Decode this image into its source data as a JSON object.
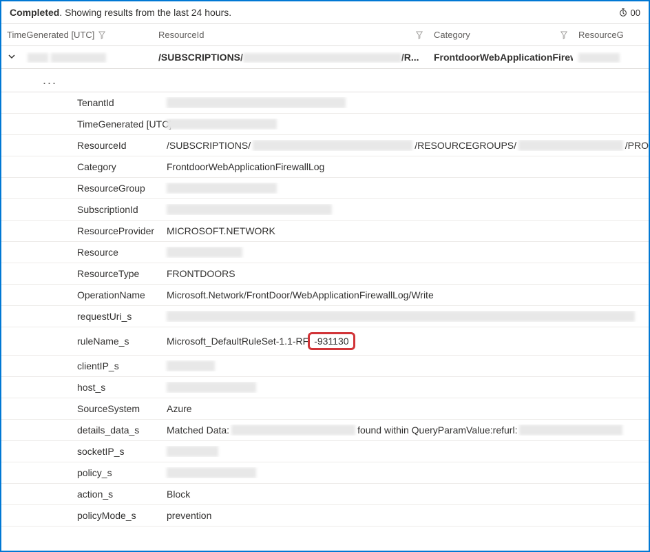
{
  "status": {
    "completed_label": "Completed",
    "subtext": ". Showing results from the last 24 hours.",
    "timer_text": "00"
  },
  "columns": {
    "time_generated": "TimeGenerated [UTC]",
    "resource_id": "ResourceId",
    "category": "Category",
    "resource_group": "ResourceG"
  },
  "result_row": {
    "resource_id_prefix": "/SUBSCRIPTIONS/",
    "resource_id_suffix": "/R...",
    "category": "FrontdoorWebApplicationFirewal..."
  },
  "ellipsis": "...",
  "details": {
    "TenantId": {
      "label": "TenantId",
      "value": ""
    },
    "TimeGenerated": {
      "label": "TimeGenerated [UTC]",
      "value": ""
    },
    "ResourceId": {
      "label": "ResourceId",
      "prefix": "/SUBSCRIPTIONS/",
      "mid": "/RESOURCEGROUPS/",
      "suffix": "/PRO"
    },
    "Category": {
      "label": "Category",
      "value": "FrontdoorWebApplicationFirewallLog"
    },
    "ResourceGroup": {
      "label": "ResourceGroup",
      "value": ""
    },
    "SubscriptionId": {
      "label": "SubscriptionId",
      "value": ""
    },
    "ResourceProvider": {
      "label": "ResourceProvider",
      "value": "MICROSOFT.NETWORK"
    },
    "Resource": {
      "label": "Resource",
      "value": ""
    },
    "ResourceType": {
      "label": "ResourceType",
      "value": "FRONTDOORS"
    },
    "OperationName": {
      "label": "OperationName",
      "value": "Microsoft.Network/FrontDoor/WebApplicationFirewallLog/Write"
    },
    "requestUri_s": {
      "label": "requestUri_s",
      "value": ""
    },
    "ruleName_s": {
      "label": "ruleName_s",
      "prefix": "Microsoft_DefaultRuleSet-1.1-RF",
      "highlighted": "-931130"
    },
    "clientIP_s": {
      "label": "clientIP_s",
      "value": ""
    },
    "host_s": {
      "label": "host_s",
      "value": ""
    },
    "SourceSystem": {
      "label": "SourceSystem",
      "value": "Azure"
    },
    "details_data_s": {
      "label": "details_data_s",
      "prefix": "Matched Data:",
      "mid": "found within QueryParamValue:refurl:"
    },
    "socketIP_s": {
      "label": "socketIP_s",
      "value": ""
    },
    "policy_s": {
      "label": "policy_s",
      "value": ""
    },
    "action_s": {
      "label": "action_s",
      "value": "Block"
    },
    "policyMode_s": {
      "label": "policyMode_s",
      "value": "prevention"
    }
  }
}
